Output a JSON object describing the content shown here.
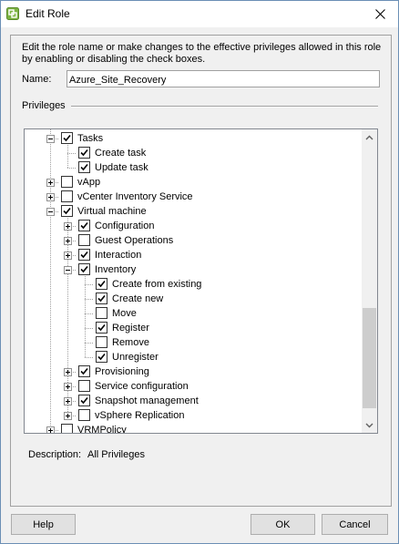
{
  "window": {
    "title": "Edit Role"
  },
  "intro_text": "Edit the role name or make changes to the effective privileges allowed in this role by enabling or disabling the check boxes.",
  "name_field": {
    "label": "Name:",
    "value": "Azure_Site_Recovery"
  },
  "privileges_label": "Privileges",
  "tree": [
    {
      "label": "Tasks",
      "level": 1,
      "expander": "minus",
      "checked": true
    },
    {
      "label": "Create task",
      "level": 2,
      "expander": "none",
      "checked": true
    },
    {
      "label": "Update task",
      "level": 2,
      "expander": "none",
      "checked": true
    },
    {
      "label": "vApp",
      "level": 1,
      "expander": "plus",
      "checked": false
    },
    {
      "label": "vCenter Inventory Service",
      "level": 1,
      "expander": "plus",
      "checked": false
    },
    {
      "label": "Virtual machine",
      "level": 1,
      "expander": "minus",
      "checked": true
    },
    {
      "label": "Configuration",
      "level": 2,
      "expander": "plus",
      "checked": true
    },
    {
      "label": "Guest Operations",
      "level": 2,
      "expander": "plus",
      "checked": false
    },
    {
      "label": "Interaction",
      "level": 2,
      "expander": "plus",
      "checked": true
    },
    {
      "label": "Inventory",
      "level": 2,
      "expander": "minus",
      "checked": true
    },
    {
      "label": "Create from existing",
      "level": 3,
      "expander": "none",
      "checked": true
    },
    {
      "label": "Create new",
      "level": 3,
      "expander": "none",
      "checked": true
    },
    {
      "label": "Move",
      "level": 3,
      "expander": "none",
      "checked": false
    },
    {
      "label": "Register",
      "level": 3,
      "expander": "none",
      "checked": true
    },
    {
      "label": "Remove",
      "level": 3,
      "expander": "none",
      "checked": false
    },
    {
      "label": "Unregister",
      "level": 3,
      "expander": "none",
      "checked": true
    },
    {
      "label": "Provisioning",
      "level": 2,
      "expander": "plus",
      "checked": true
    },
    {
      "label": "Service configuration",
      "level": 2,
      "expander": "plus",
      "checked": false
    },
    {
      "label": "Snapshot management",
      "level": 2,
      "expander": "plus",
      "checked": true
    },
    {
      "label": "vSphere Replication",
      "level": 2,
      "expander": "plus",
      "checked": false
    },
    {
      "label": "VRMPolicy",
      "level": 1,
      "expander": "plus",
      "checked": false
    }
  ],
  "description": {
    "label": "Description:",
    "value": "All Privileges"
  },
  "buttons": {
    "help": "Help",
    "ok": "OK",
    "cancel": "Cancel"
  },
  "icons": {
    "app": "vsphere-app-icon",
    "close": "close-icon",
    "scroll_up": "scroll-up-arrow-icon",
    "scroll_down": "scroll-down-arrow-icon",
    "check": "checkmark-icon"
  },
  "colors": {
    "window_border": "#6b8fb5",
    "app_icon_green": "#7cb342",
    "dialog_bg": "#f0f0f0"
  }
}
